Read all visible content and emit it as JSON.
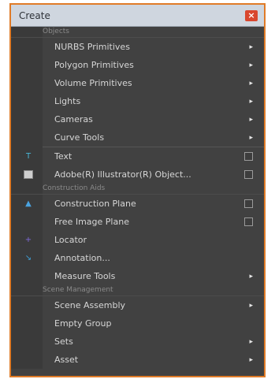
{
  "window": {
    "title": "Create",
    "close_label": "×"
  },
  "sections": {
    "objects": "Objects",
    "construction_aids": "Construction Aids",
    "scene_management": "Scene Management"
  },
  "items": {
    "nurbs": "NURBS Primitives",
    "polygon": "Polygon Primitives",
    "volume": "Volume Primitives",
    "lights": "Lights",
    "cameras": "Cameras",
    "curve_tools": "Curve Tools",
    "text": "Text",
    "adobe": "Adobe(R) Illustrator(R) Object...",
    "construction_plane": "Construction Plane",
    "free_image_plane": "Free Image Plane",
    "locator": "Locator",
    "annotation": "Annotation...",
    "measure_tools": "Measure Tools",
    "scene_assembly": "Scene Assembly",
    "empty_group": "Empty Group",
    "sets": "Sets",
    "asset": "Asset"
  },
  "glyphs": {
    "submenu_arrow": "▸"
  },
  "colors": {
    "accent_border": "#e07b27",
    "panel_bg": "#414141",
    "titlebar_bg": "#cfd6df",
    "close_bg": "#d9472e"
  }
}
